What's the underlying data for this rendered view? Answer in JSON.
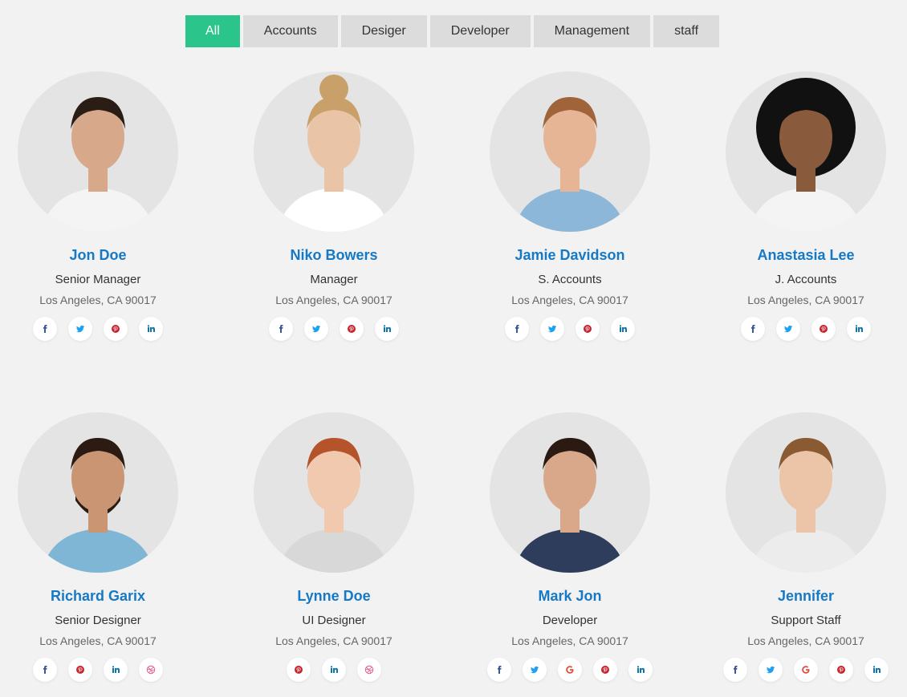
{
  "filters": [
    "All",
    "Accounts",
    "Desiger",
    "Developer",
    "Management",
    "staff"
  ],
  "active_filter": "All",
  "colors": {
    "accent": "#2bc58b",
    "name": "#1679c5",
    "facebook": "#3b5998",
    "twitter": "#1da1f2",
    "pinterest": "#c8232c",
    "linkedin": "#0e76a8",
    "google": "#dd4b39",
    "dribbble": "#ea4c89"
  },
  "members": [
    {
      "name": "Jon Doe",
      "role": "Senior Manager",
      "address": "Los Angeles, CA 90017",
      "socials": [
        "facebook",
        "twitter",
        "pinterest",
        "linkedin"
      ]
    },
    {
      "name": "Niko Bowers",
      "role": "Manager",
      "address": "Los Angeles, CA 90017",
      "socials": [
        "facebook",
        "twitter",
        "pinterest",
        "linkedin"
      ]
    },
    {
      "name": "Jamie Davidson",
      "role": "S. Accounts",
      "address": "Los Angeles, CA 90017",
      "socials": [
        "facebook",
        "twitter",
        "pinterest",
        "linkedin"
      ]
    },
    {
      "name": "Anastasia Lee",
      "role": "J. Accounts",
      "address": "Los Angeles, CA 90017",
      "socials": [
        "facebook",
        "twitter",
        "pinterest",
        "linkedin"
      ]
    },
    {
      "name": "Richard Garix",
      "role": "Senior Designer",
      "address": "Los Angeles, CA 90017",
      "socials": [
        "facebook",
        "pinterest",
        "linkedin",
        "dribbble"
      ]
    },
    {
      "name": "Lynne Doe",
      "role": "UI Designer",
      "address": "Los Angeles, CA 90017",
      "socials": [
        "pinterest",
        "linkedin",
        "dribbble"
      ]
    },
    {
      "name": "Mark Jon",
      "role": "Developer",
      "address": "Los Angeles, CA 90017",
      "socials": [
        "facebook",
        "twitter",
        "google",
        "pinterest",
        "linkedin"
      ]
    },
    {
      "name": "Jennifer",
      "role": "Support Staff",
      "address": "Los Angeles, CA 90017",
      "socials": [
        "facebook",
        "twitter",
        "google",
        "pinterest",
        "linkedin"
      ]
    }
  ]
}
